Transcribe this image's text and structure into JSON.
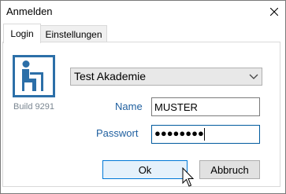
{
  "window": {
    "title": "Anmelden"
  },
  "tabs": [
    {
      "label": "Login",
      "active": true
    },
    {
      "label": "Einstellungen",
      "active": false
    }
  ],
  "logo": {
    "icon": "person-at-desk-icon",
    "color": "#2c6fa8"
  },
  "build_label": "Build 9291",
  "academy_select": {
    "selected": "Test Akademie"
  },
  "name_field": {
    "label": "Name",
    "value": "MUSTER"
  },
  "password_field": {
    "label": "Passwort",
    "value": "●●●●●●●●"
  },
  "buttons": {
    "ok": "Ok",
    "cancel": "Abbruch"
  },
  "colors": {
    "accent": "#0078d7",
    "label": "#1f5f9f",
    "logo": "#2c6fa8"
  }
}
